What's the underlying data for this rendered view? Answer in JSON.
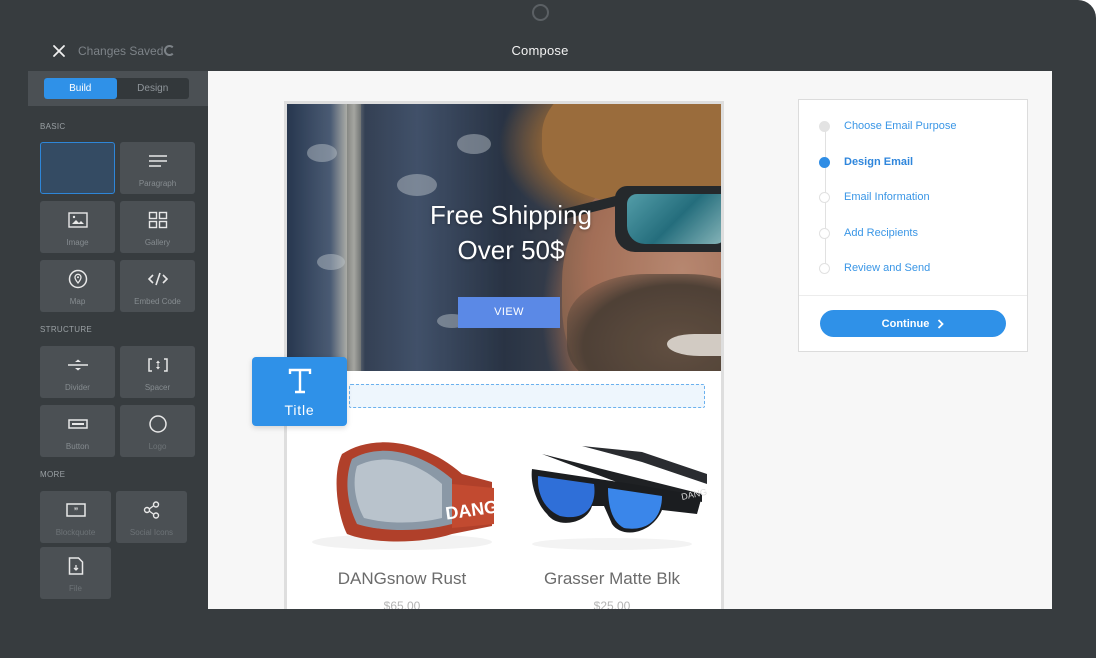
{
  "window": {
    "title": "Compose",
    "save_status": "Changes Saved",
    "close_icon": "close-icon",
    "status_icon": "spinner-icon"
  },
  "sidebar": {
    "mode_toggle": {
      "options": [
        "Build",
        "Design"
      ],
      "selected": "Build"
    },
    "sections": [
      {
        "label": "BASIC",
        "items": [
          {
            "label": "",
            "icon": "title-block-placeholder",
            "state": "selected"
          },
          {
            "label": "Paragraph",
            "icon": "paragraph-icon"
          },
          {
            "label": "Image",
            "icon": "image-icon"
          },
          {
            "label": "Gallery",
            "icon": "gallery-icon"
          },
          {
            "label": "Map",
            "icon": "map-pin-icon"
          },
          {
            "label": "Embed Code",
            "icon": "code-icon"
          }
        ]
      },
      {
        "label": "STRUCTURE",
        "items": [
          {
            "label": "Divider",
            "icon": "divider-icon"
          },
          {
            "label": "Spacer",
            "icon": "spacer-icon"
          },
          {
            "label": "Button",
            "icon": "button-icon"
          },
          {
            "label": "Logo",
            "icon": "logo-circle-icon"
          }
        ]
      },
      {
        "label": "MORE",
        "items": [
          {
            "label": "Blockquote",
            "icon": "quote-icon"
          },
          {
            "label": "Social Icons",
            "icon": "share-icon"
          },
          {
            "label": "File",
            "icon": "file-download-icon"
          }
        ]
      }
    ]
  },
  "email": {
    "hero": {
      "headline_line1": "Free Shipping",
      "headline_line2": "Over 50$",
      "cta_label": "VIEW",
      "cta_color": "#5b89e6"
    },
    "products": [
      {
        "name": "DANGsnow Rust",
        "price": "$65.00",
        "image": "red ski goggles"
      },
      {
        "name": "Grasser Matte Blk",
        "price": "$25.00",
        "image": "black sunglasses blue lenses"
      }
    ]
  },
  "drag_ghost": {
    "label": "Title",
    "icon": "text-t-icon"
  },
  "steps": {
    "items": [
      {
        "label": "Choose Email Purpose",
        "state": "done"
      },
      {
        "label": "Design Email",
        "state": "current"
      },
      {
        "label": "Email Information",
        "state": "pending"
      },
      {
        "label": "Add Recipients",
        "state": "pending"
      },
      {
        "label": "Review and Send",
        "state": "pending"
      }
    ],
    "continue_label": "Continue",
    "continue_icon": "chevron-right-icon"
  },
  "colors": {
    "accent": "#2f91e8",
    "frame": "#373c3f",
    "canvas": "#f7f7f7"
  }
}
